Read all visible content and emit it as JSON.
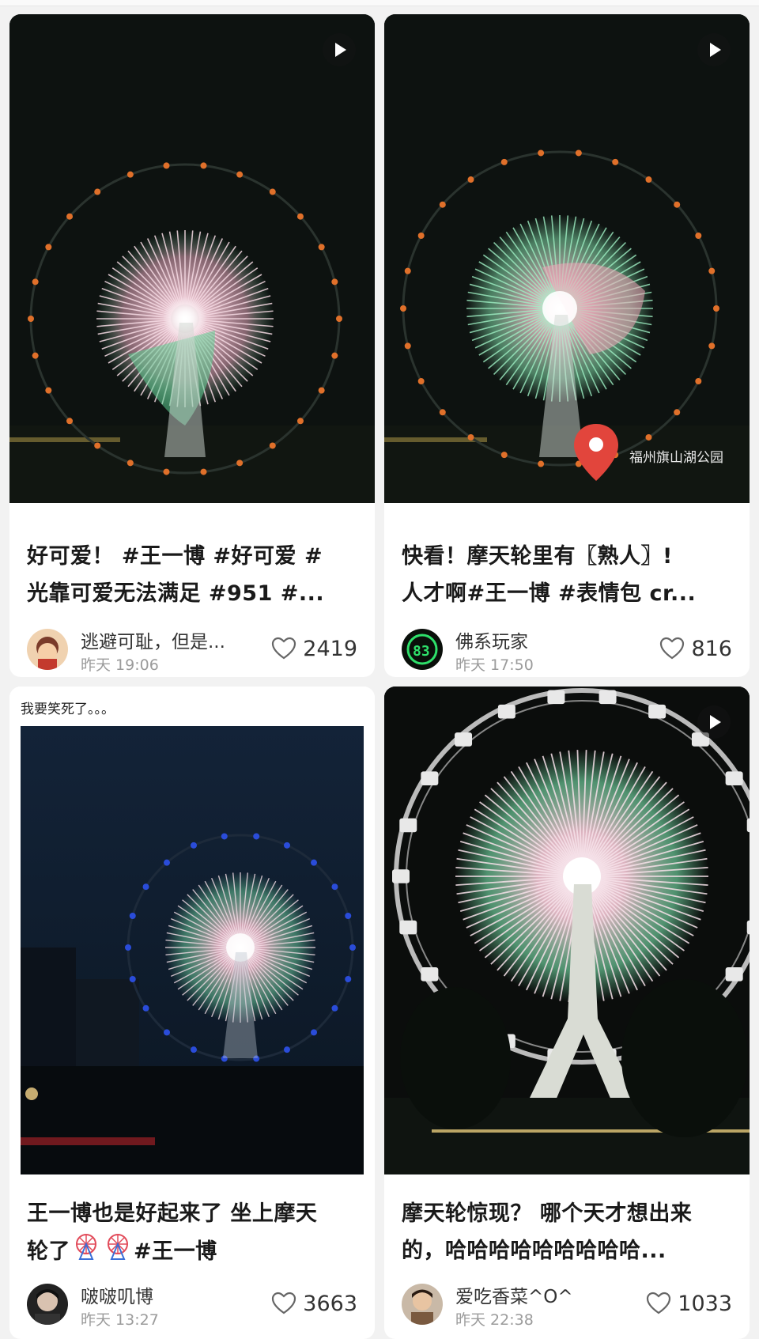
{
  "cards": [
    {
      "title_line1": "好可爱！ #王一博 #好可爱 #",
      "title_line2": "光靠可爱无法满足 #951 #...",
      "author": "逃避可耻，但是...",
      "time": "昨天 19:06",
      "likes": "2419",
      "has_video": true
    },
    {
      "title_line1": "快看！摩天轮里有〖熟人〗!",
      "title_line2": "人才啊#王一博 #表情包  cr...",
      "author": "佛系玩家",
      "time": "昨天 17:50",
      "likes": "816",
      "has_video": true,
      "location_tag": "福州旗山湖公园"
    },
    {
      "caption": "我要笑死了。。。",
      "title_line1": "王一博也是好起来了 坐上摩天",
      "title_line2_prefix": "轮了",
      "title_line2_suffix": "#王一博",
      "author": "啵啵叽博",
      "time": "昨天 13:27",
      "likes": "3663",
      "has_video": false
    },
    {
      "title_line1": "摩天轮惊现？ 哪个天才想出来",
      "title_line2": "的，哈哈哈哈哈哈哈哈哈...",
      "author": "爱吃香菜^O^",
      "time": "昨天 22:38",
      "likes": "1033",
      "has_video": true
    }
  ],
  "colors": {
    "accent_pink": "#f3b8c8",
    "accent_green": "#6fd6a0",
    "pin_red": "#e2453c"
  },
  "icons": [
    "play-icon",
    "heart-icon",
    "location-pin-icon",
    "ferris-wheel-emoji"
  ]
}
